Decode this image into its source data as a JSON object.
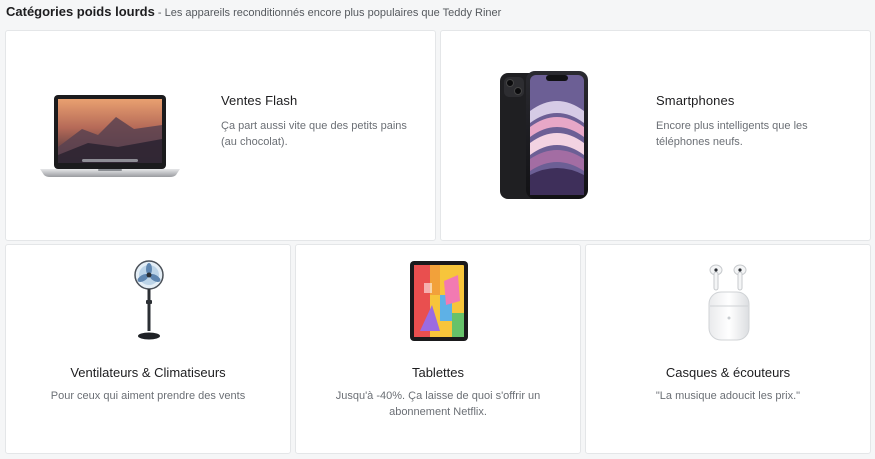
{
  "header": {
    "title": "Catégories poids lourds",
    "separator": " - ",
    "subtitle": "Les appareils reconditionnés encore plus populaires que Teddy Riner"
  },
  "categories": [
    {
      "name": "Ventes Flash",
      "description": "Ça part aussi vite que des petits pains (au chocolat).",
      "icon": "laptop-icon"
    },
    {
      "name": "Smartphones",
      "description": "Encore plus intelligents que les téléphones neufs.",
      "icon": "smartphone-icon"
    },
    {
      "name": "Ventilateurs & Climatiseurs",
      "description": "Pour ceux qui aiment prendre des vents",
      "icon": "fan-icon"
    },
    {
      "name": "Tablettes",
      "description": "Jusqu'à -40%. Ça laisse de quoi s'offrir un abonnement Netflix.",
      "icon": "tablet-icon"
    },
    {
      "name": "Casques & écouteurs",
      "description": "\"La musique adoucit les prix.\"",
      "icon": "earbuds-icon"
    }
  ]
}
